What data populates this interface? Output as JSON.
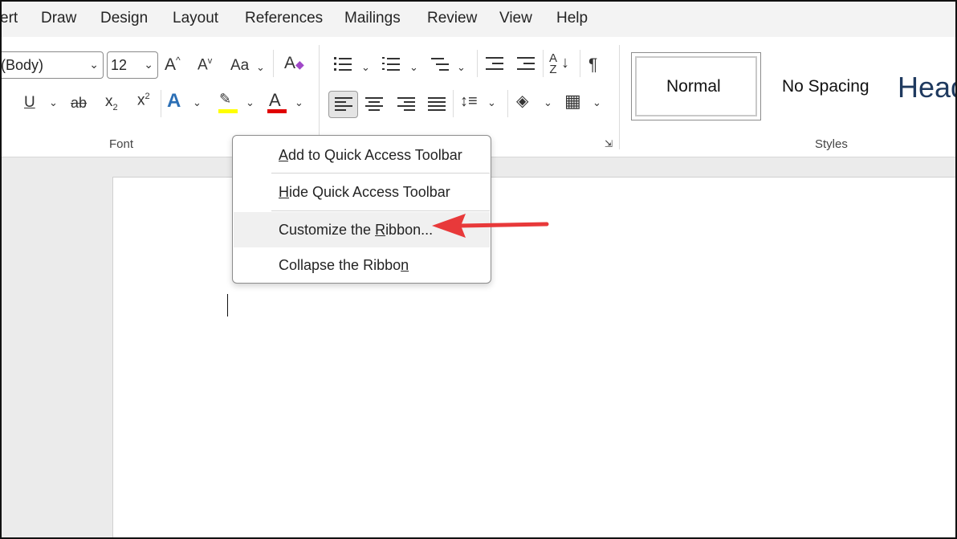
{
  "tabs": [
    "ert",
    "Draw",
    "Design",
    "Layout",
    "References",
    "Mailings",
    "Review",
    "View",
    "Help"
  ],
  "font": {
    "name_value": "(Body)",
    "size_value": "12",
    "change_case_label": "Aa",
    "group_label": "Font"
  },
  "styles": {
    "normal_label": "Normal",
    "no_spacing_label": "No Spacing",
    "heading_label": "Head",
    "group_label": "Styles"
  },
  "context_menu": {
    "items": [
      {
        "label": "Add to Quick Access Toolbar",
        "key": "A"
      },
      {
        "label": "Hide Quick Access Toolbar",
        "key": "H"
      },
      {
        "label": "Customize the Ribbon...",
        "key": "R"
      },
      {
        "label": "Collapse the Ribbon",
        "key": "n"
      }
    ]
  },
  "colors": {
    "highlight": "#ffff00",
    "font_color": "#e00000",
    "annotation_arrow": "#e8393a",
    "heading_style": "#1f3a5f"
  }
}
